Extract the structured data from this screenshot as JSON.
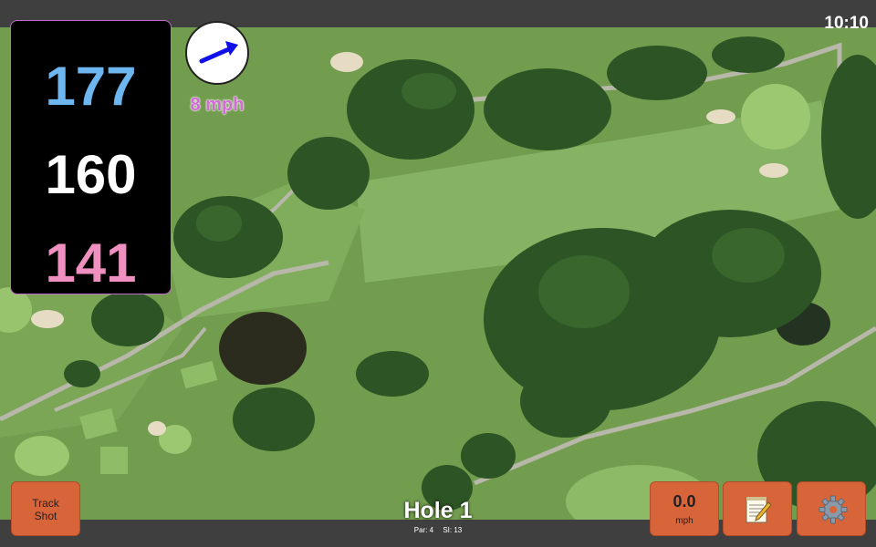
{
  "clock": "10:10",
  "distances": {
    "back": "177",
    "middle": "160",
    "front": "141"
  },
  "wind": {
    "speed_label": "8 mph",
    "icon": "wind-direction-arrow"
  },
  "buttons": {
    "track_shot_line1": "Track",
    "track_shot_line2": "Shot",
    "speed_value": "0.0",
    "speed_unit": "mph",
    "notes_icon": "notepad-icon",
    "settings_icon": "gear-icon"
  },
  "hole": {
    "title": "Hole 1",
    "par": "Par: 4",
    "si": "SI: 13"
  },
  "colors": {
    "back": "#6eb6f0",
    "middle": "#ffffff",
    "front": "#f090c0",
    "button": "#d8643a",
    "wind_text": "#d36ad8"
  }
}
